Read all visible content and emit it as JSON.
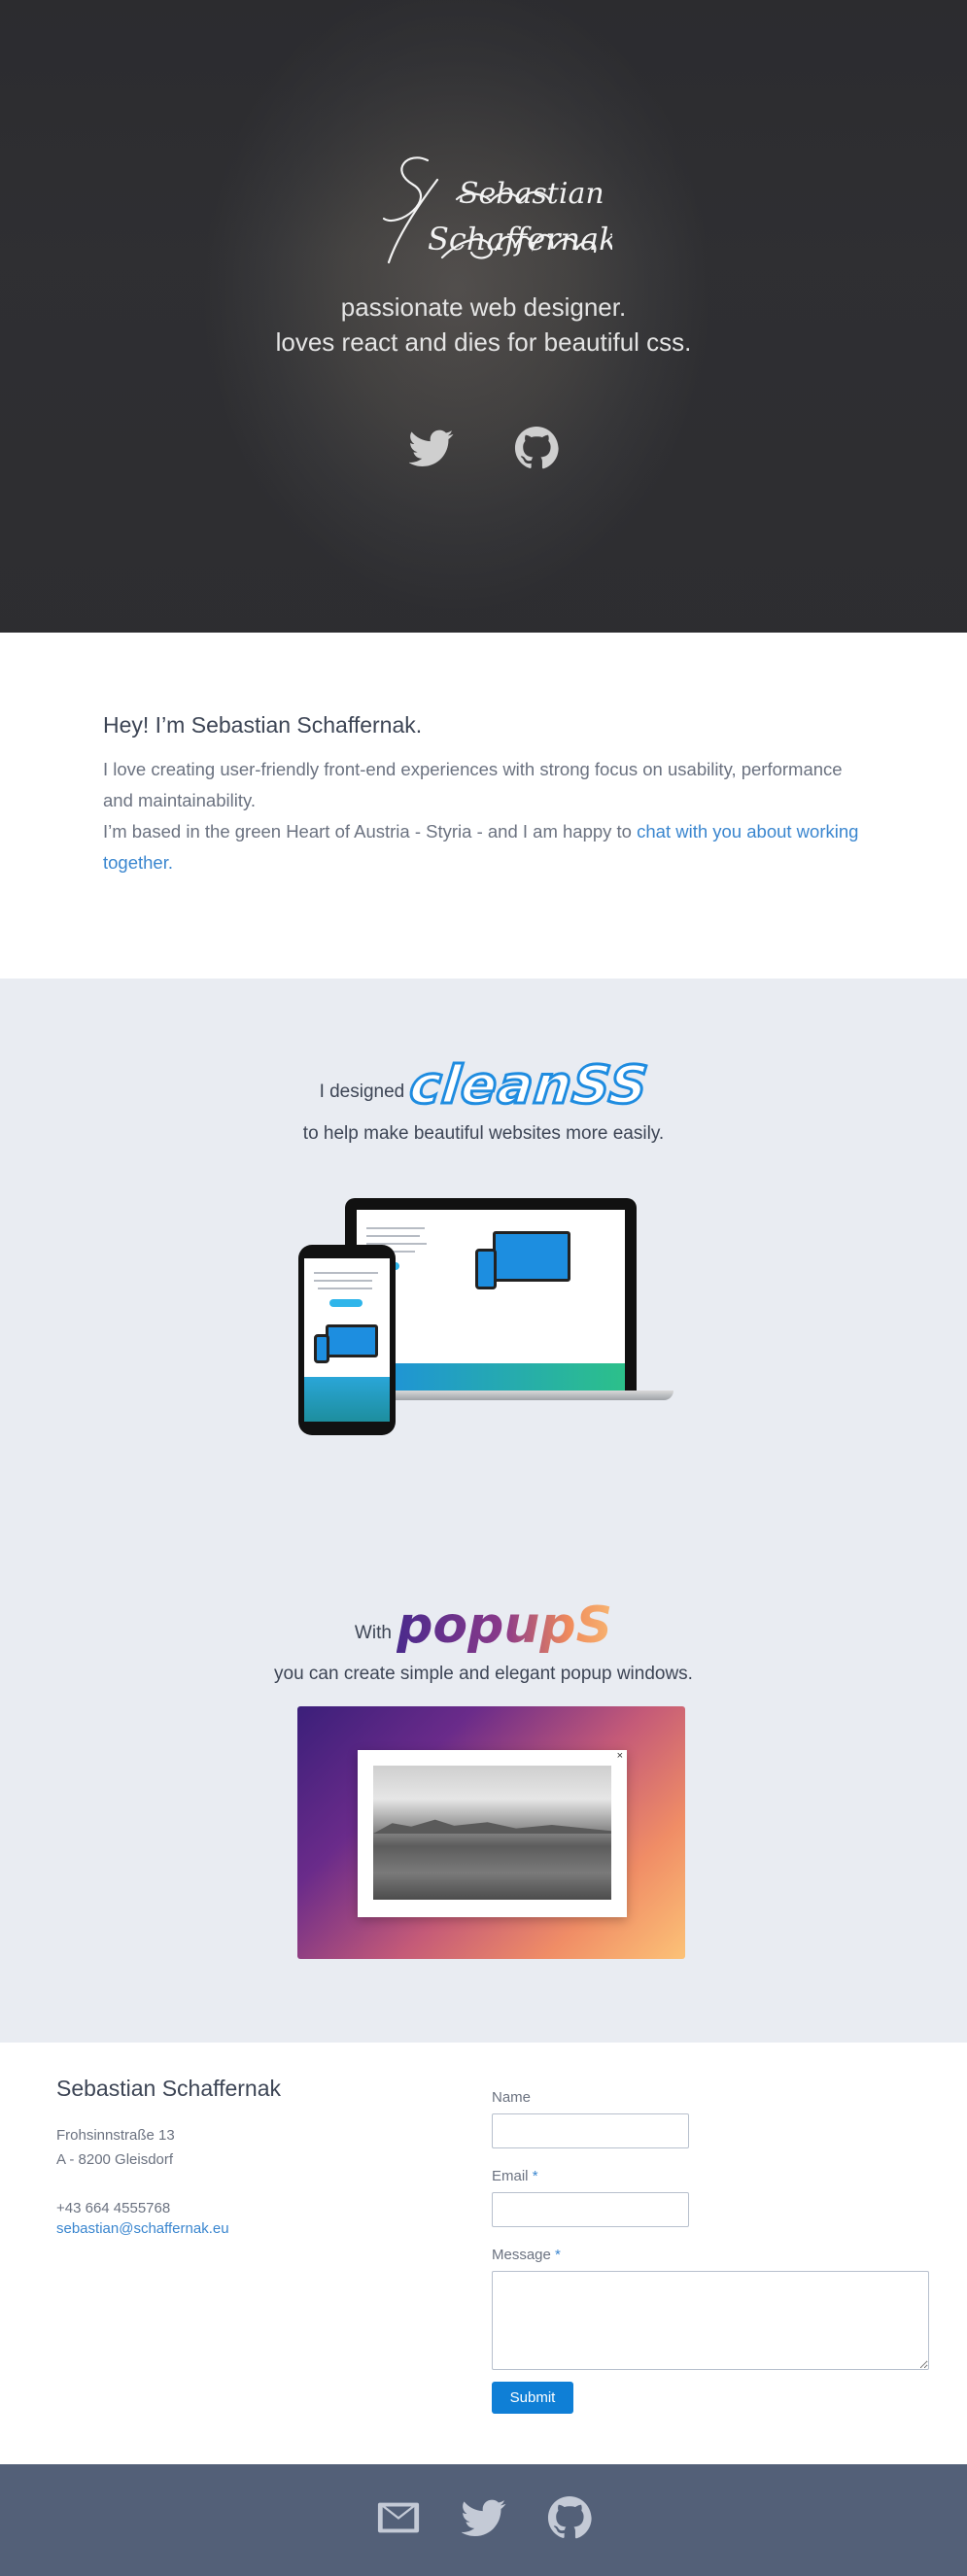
{
  "hero": {
    "signature_line1": "Sebastian",
    "signature_line2": "Schaffernak",
    "tagline_line1": "passionate web designer.",
    "tagline_line2": "loves react and dies for beautiful css.",
    "social_icons": [
      "twitter-icon",
      "github-icon"
    ]
  },
  "intro": {
    "heading": "Hey! I’m Sebastian Schaffernak.",
    "paragraph1": "I love creating user-friendly front-end experiences with strong focus on usability, performance and maintainability.",
    "paragraph2": "I’m based in the green Heart of Austria - Styria - and I am happy to ",
    "link_text": "chat with you about working together."
  },
  "projects": {
    "clean": {
      "prefix": "I designed",
      "logo": "cleanSS",
      "description": "to help make beautiful websites more easily."
    },
    "popup": {
      "prefix": "With",
      "logo": "popupS",
      "description": "you can create simple and elegant popup windows.",
      "close_symbol": "×"
    }
  },
  "contact": {
    "name": "Sebastian Schaffernak",
    "street": "Frohsinnstraße 13",
    "city": "A - 8200 Gleisdorf",
    "phone": "+43 664 4555768",
    "email": "sebastian@schaffernak.eu",
    "form": {
      "name_label": "Name",
      "email_label": "Email",
      "message_label": "Message",
      "required_marker": "*",
      "submit_label": "Submit"
    }
  },
  "footer": {
    "icons": [
      "mail-icon",
      "twitter-icon",
      "github-icon"
    ]
  },
  "colors": {
    "accent": "#3a86cf",
    "button": "#0f7fd6",
    "footer_bg": "#536078",
    "projects_bg": "#e9ecf2"
  }
}
